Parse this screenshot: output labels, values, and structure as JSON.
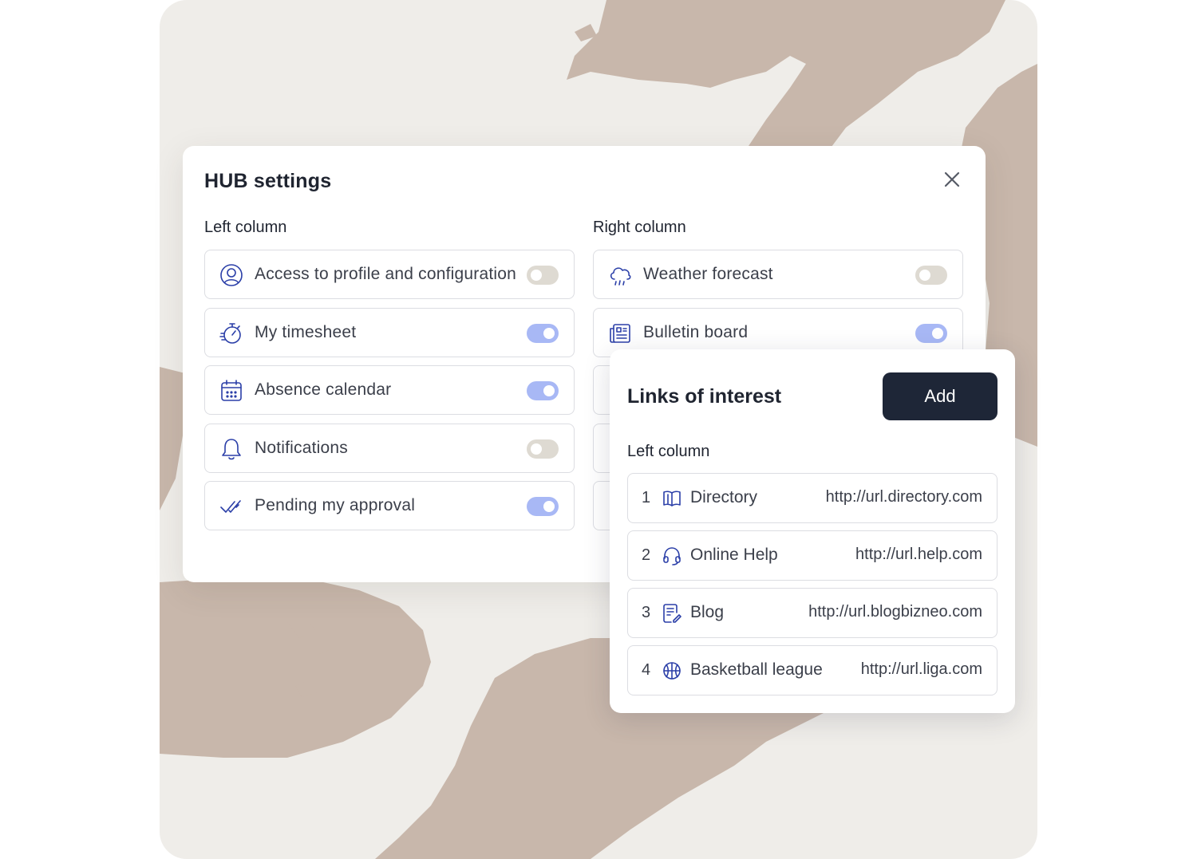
{
  "modal": {
    "title": "HUB settings",
    "left_column_label": "Left column",
    "right_column_label": "Right column",
    "left_items": [
      {
        "label": "Access to profile and configuration",
        "icon": "user-circle-icon",
        "enabled": false
      },
      {
        "label": "My timesheet",
        "icon": "stopwatch-icon",
        "enabled": true
      },
      {
        "label": "Absence calendar",
        "icon": "calendar-icon",
        "enabled": true
      },
      {
        "label": "Notifications",
        "icon": "bell-icon",
        "enabled": false
      },
      {
        "label": "Pending my approval",
        "icon": "double-check-icon",
        "enabled": true
      }
    ],
    "right_items": [
      {
        "label": "Weather forecast",
        "icon": "cloud-rain-icon",
        "enabled": false
      },
      {
        "label": "Bulletin board",
        "icon": "newspaper-icon",
        "enabled": true
      }
    ]
  },
  "links_panel": {
    "title": "Links of interest",
    "add_label": "Add",
    "column_label": "Left column",
    "items": [
      {
        "number": "1",
        "name": "Directory",
        "url": "http://url.directory.com",
        "icon": "book-open-icon"
      },
      {
        "number": "2",
        "name": "Online Help",
        "url": "http://url.help.com",
        "icon": "headset-icon"
      },
      {
        "number": "3",
        "name": "Blog",
        "url": "http://url.blogbizneo.com",
        "icon": "note-edit-icon"
      },
      {
        "number": "4",
        "name": "Basketball league",
        "url": "http://url.liga.com",
        "icon": "basketball-icon"
      }
    ]
  },
  "colors": {
    "icon": "#2b3fa8",
    "toggle_on": "#a8b8f5",
    "toggle_off": "#dedad2",
    "add_button": "#1e2637",
    "backdrop": "#efede9",
    "map_land": "#c8b7ab"
  }
}
